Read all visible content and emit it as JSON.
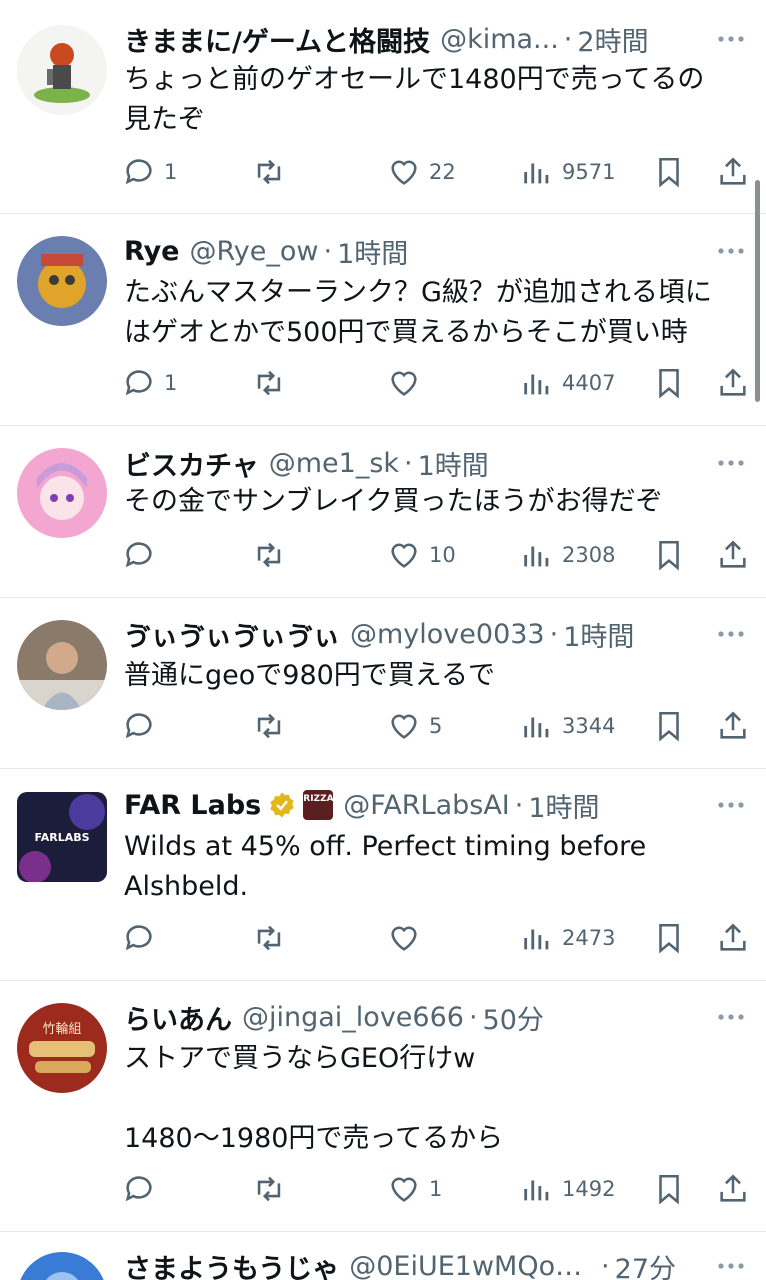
{
  "tweets": [
    {
      "name": "きままに/ゲームと格闘技",
      "handle": "@kima...",
      "dot": "·",
      "time": "2時間",
      "text": "ちょっと前のゲオセールで1480円で売ってるの\n見たぞ",
      "replies": "1",
      "likes": "22",
      "views": "9571"
    },
    {
      "name": "Rye",
      "handle": "@Rye_ow",
      "dot": "·",
      "time": "1時間",
      "text": "たぶんマスターランク？G級？が追加される頃に\nはゲオとかで500円で買えるからそこが買い時",
      "replies": "1",
      "likes": "",
      "views": "4407"
    },
    {
      "name": "ビスカチャ",
      "handle": "@me1_sk",
      "dot": "·",
      "time": "1時間",
      "text": "その金でサンブレイク買ったほうがお得だぞ",
      "replies": "",
      "likes": "10",
      "views": "2308"
    },
    {
      "name": "ゔぃゔぃゔぃゔぃ",
      "handle": "@mylove0033",
      "dot": "·",
      "time": "1時間",
      "text": "普通にgeoで980円で買えるで",
      "replies": "",
      "likes": "5",
      "views": "3344"
    },
    {
      "name": "FAR Labs",
      "handle": "@FARLabsAI",
      "dot": "·",
      "time": "1時間",
      "text": "Wilds at 45% off. Perfect timing before\nAlshbeld.",
      "replies": "",
      "likes": "",
      "views": "2473",
      "badge_text": "RIZZA RACT",
      "avatar_text": "FARLABS"
    },
    {
      "name": "らいあん",
      "handle": "@jingai_love666",
      "dot": "·",
      "time": "50分",
      "text": "ストアで買うならGEO行けw\n\n1480〜1980円で売ってるから",
      "replies": "",
      "likes": "1",
      "views": "1492",
      "avatar_text": "竹輪組"
    },
    {
      "name": "さまようもうじゃ",
      "handle": "@0EiUE1wMQon...",
      "dot": "·",
      "time": "27分"
    }
  ],
  "colors": {
    "text": "#0f1419",
    "secondary": "#536471",
    "divider": "#e6e9ec",
    "verified": "#e2b719"
  },
  "icons": [
    "reply-icon",
    "retweet-icon",
    "like-icon",
    "views-icon",
    "bookmark-icon",
    "share-icon",
    "more-icon",
    "verified-badge-icon"
  ]
}
